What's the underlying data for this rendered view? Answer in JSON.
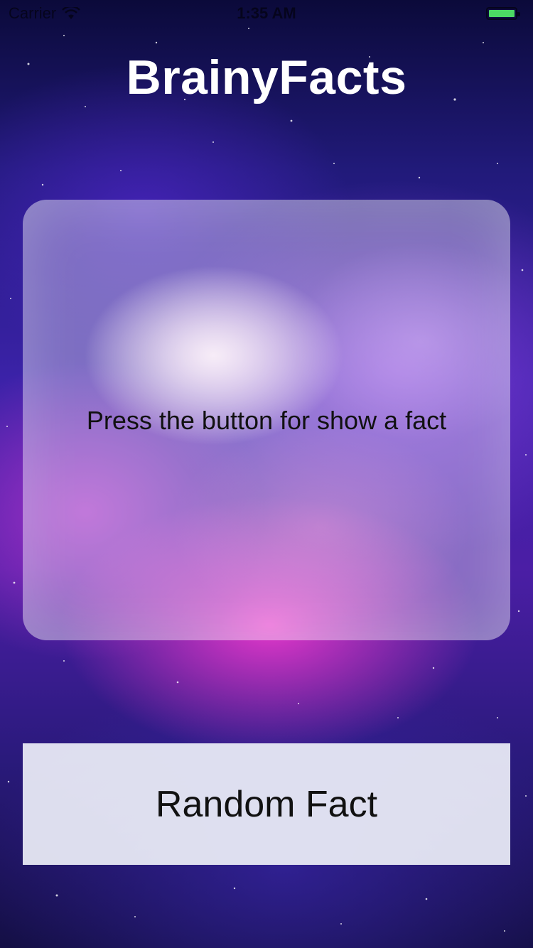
{
  "status_bar": {
    "carrier": "Carrier",
    "time": "1:35 AM",
    "battery_color": "#4cd964"
  },
  "header": {
    "title": "BrainyFacts"
  },
  "card": {
    "fact_text": "Press the button for show a fact"
  },
  "button": {
    "label": "Random Fact"
  },
  "icons": {
    "wifi": "wifi-icon",
    "battery": "battery-icon"
  },
  "colors": {
    "title": "#ffffff",
    "text": "#111111",
    "button_bg": "#eceef8"
  }
}
